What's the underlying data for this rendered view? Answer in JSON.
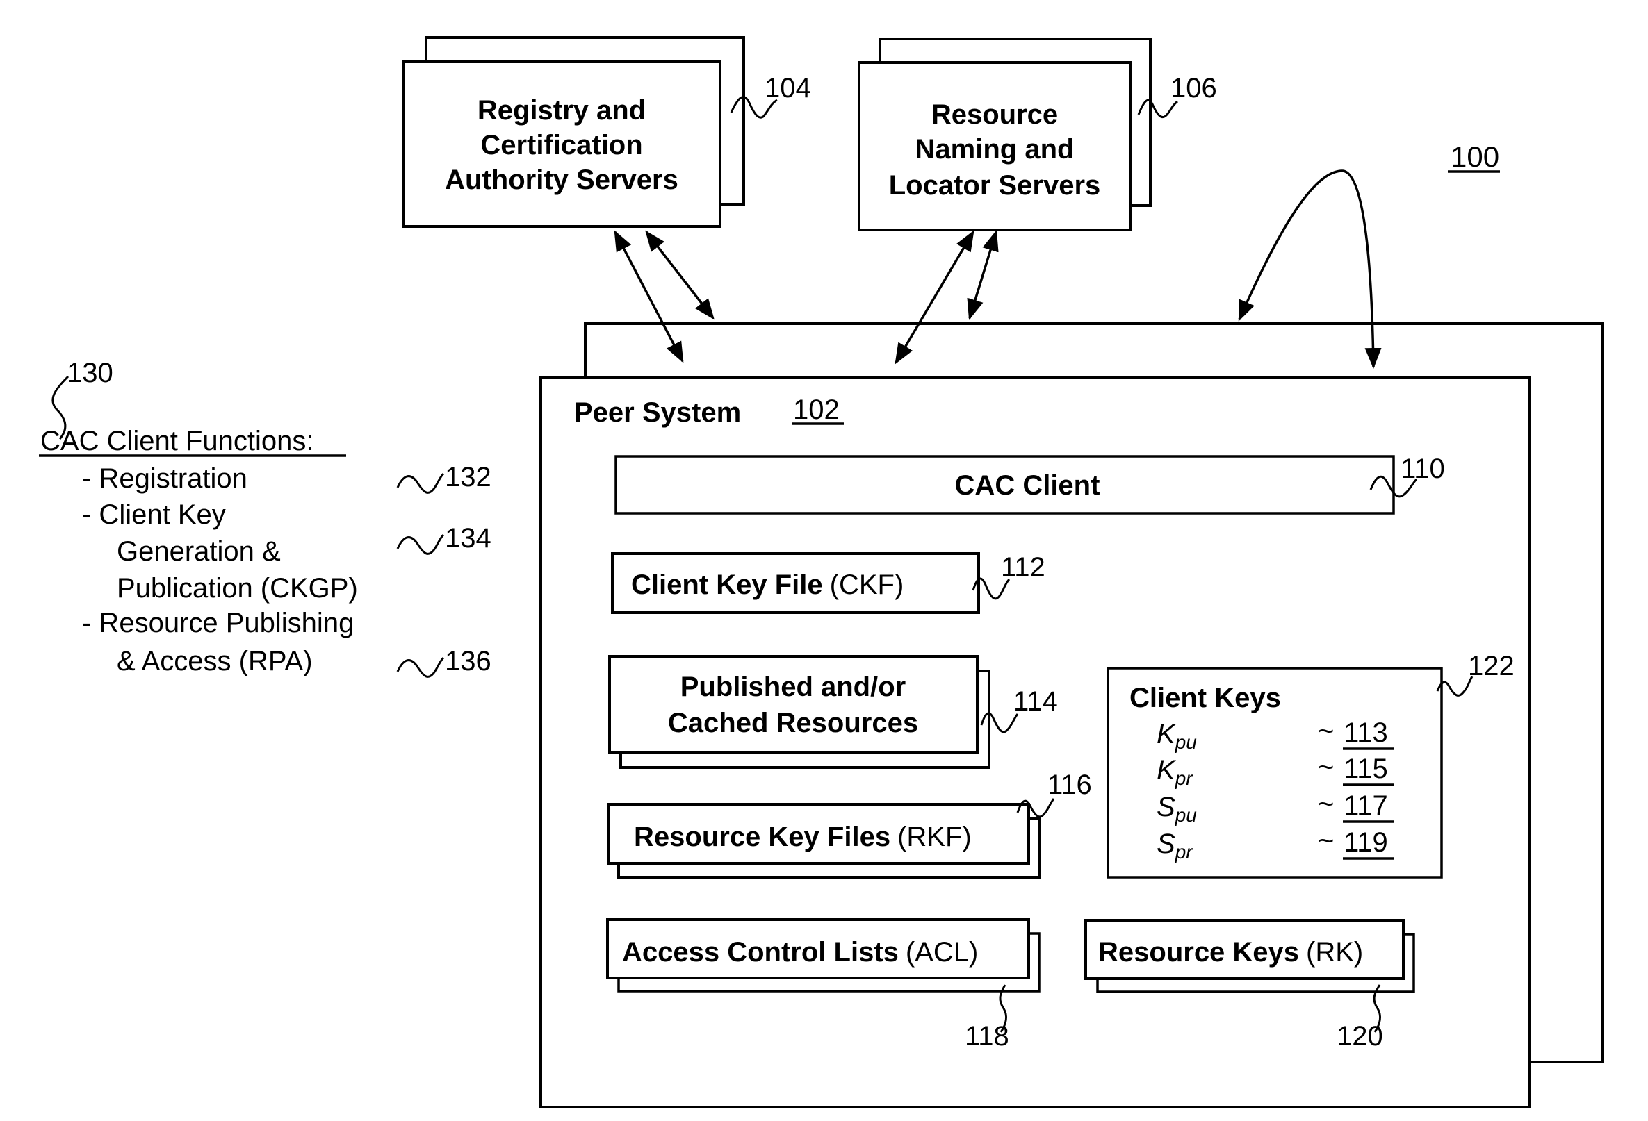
{
  "figure": {
    "label": "100",
    "registry_servers": {
      "ref": "104",
      "lines": [
        "Registry and",
        "Certification",
        "Authority Servers"
      ]
    },
    "naming_servers": {
      "ref": "106",
      "lines": [
        "Resource",
        "Naming and",
        "Locator Servers"
      ]
    },
    "client_functions": {
      "ref": "130",
      "title": "CAC Client Functions:",
      "items": [
        {
          "lines": [
            "- Registration"
          ],
          "ref": "132"
        },
        {
          "lines": [
            "- Client Key",
            "Generation &",
            "Publication (CKGP)"
          ],
          "ref": "134"
        },
        {
          "lines": [
            "- Resource Publishing",
            "& Access (RPA)"
          ],
          "ref": "136"
        }
      ]
    },
    "peer_system": {
      "title": "Peer System",
      "ref": "102",
      "cac_client": {
        "label": "CAC Client",
        "ref": "110"
      },
      "client_key_file": {
        "label_bold": "Client Key File",
        "label_abbr": "(CKF)",
        "ref": "112"
      },
      "published_resources": {
        "lines": [
          "Published and/or",
          "Cached Resources"
        ],
        "ref": "114"
      },
      "resource_key_files": {
        "label_bold": "Resource Key Files",
        "label_abbr": "(RKF)",
        "ref": "116"
      },
      "access_control_lists": {
        "label_bold": "Access Control Lists",
        "label_abbr": "(ACL)",
        "ref": "118"
      },
      "resource_keys": {
        "label_bold": "Resource Keys",
        "label_abbr": "(RK)",
        "ref": "120"
      },
      "client_keys": {
        "title": "Client Keys",
        "ref": "122",
        "keys": [
          {
            "base": "K",
            "sub": "pu",
            "ref": "113"
          },
          {
            "base": "K",
            "sub": "pr",
            "ref": "115"
          },
          {
            "base": "S",
            "sub": "pu",
            "ref": "117"
          },
          {
            "base": "S",
            "sub": "pr",
            "ref": "119"
          }
        ]
      }
    }
  }
}
